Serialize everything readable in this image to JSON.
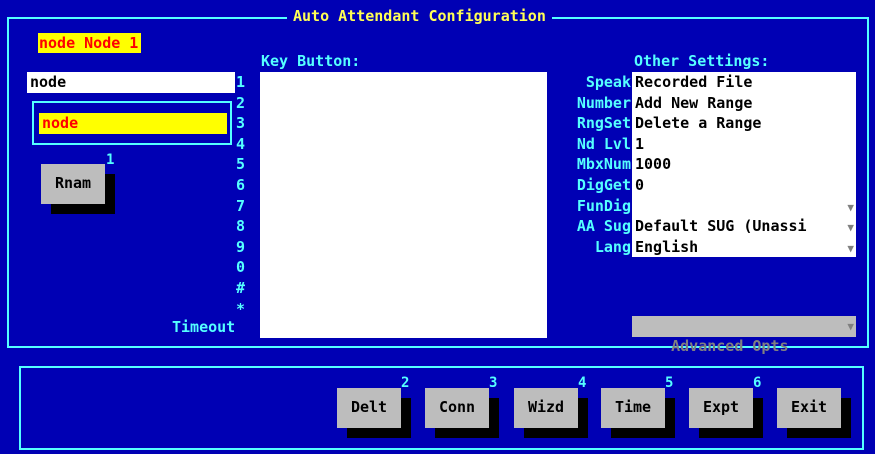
{
  "window": {
    "title": "Auto Attendant Configuration"
  },
  "node_header": "node Node 1",
  "left": {
    "node_field": "node",
    "node_highlight_field": "node",
    "rnam": {
      "hotkey": "1",
      "label": "Rnam"
    }
  },
  "key_button": {
    "header": "Key Button:",
    "keys": [
      "1",
      "2",
      "3",
      "4",
      "5",
      "6",
      "7",
      "8",
      "9",
      "0",
      "#",
      "*"
    ],
    "timeout_label": "Timeout"
  },
  "other_settings": {
    "header": "Other Settings:",
    "rows": [
      {
        "label": "Speak",
        "value": "Recorded File"
      },
      {
        "label": "Number",
        "value": "Add New Range"
      },
      {
        "label": "RngSet",
        "value": "Delete a Range"
      },
      {
        "label": "Nd Lvl",
        "value": "1"
      },
      {
        "label": "MbxNum",
        "value": "1000"
      },
      {
        "label": "DigGet",
        "value": "0"
      },
      {
        "label": "FunDig",
        "value": ""
      },
      {
        "label": "AA Sug",
        "value": "Default SUG (Unassi"
      },
      {
        "label": "Lang",
        "value": "English"
      }
    ],
    "advanced": "Advanced Opts"
  },
  "bottom_buttons": [
    {
      "hotkey": "2",
      "label": "Delt"
    },
    {
      "hotkey": "3",
      "label": "Conn"
    },
    {
      "hotkey": "4",
      "label": "Wizd"
    },
    {
      "hotkey": "5",
      "label": "Time"
    },
    {
      "hotkey": "6",
      "label": "Expt"
    },
    {
      "hotkey": "",
      "label": "Exit"
    }
  ],
  "colors": {
    "background": "#0000b4",
    "frame": "#55ffff",
    "title": "#ffff55",
    "highlight": "#ffff00",
    "highlight_text": "#ff0000",
    "button": "#bdbdbd"
  }
}
